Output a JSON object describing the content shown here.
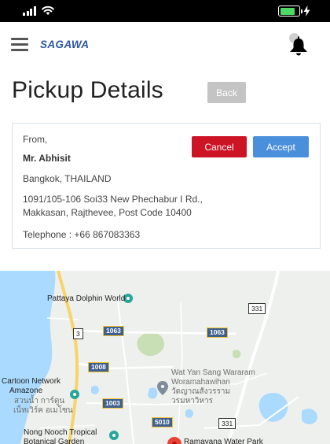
{
  "status_bar": {
    "icons": [
      "signal-icon",
      "wifi-icon",
      "battery-icon",
      "charging-bolt-icon"
    ],
    "battery_level": 0.85
  },
  "header": {
    "brand": "SAGAWA",
    "menu_icon": "hamburger-menu-icon",
    "notification_icon": "bell-icon"
  },
  "page": {
    "title": "Pickup Details",
    "back_label": "Back"
  },
  "pickup": {
    "from_label": "From,",
    "name": "Mr. Abhisit",
    "city": "Bangkok, THAILAND",
    "address_line1": "1091/105-106 Soi33 New Phechabur I Rd.,",
    "address_line2": "Makkasan, Rajthevee, Post Code 10400",
    "telephone": "Telephone : +66 867083363",
    "cancel_label": "Cancel",
    "accept_label": "Accept"
  },
  "map": {
    "places": {
      "dolphin_world": "Pattaya Dolphin World",
      "cartoon_network_1": "Cartoon Network",
      "cartoon_network_2": "Amazone",
      "cartoon_network_thai_1": "สวนน้ำ การ์ตูน",
      "cartoon_network_thai_2": "เน็ทเวิร์ค อเมโซน",
      "wat_yan_1": "Wat Yan Sang Wararam",
      "wat_yan_2": "Woramahawihan",
      "wat_yan_thai_1": "วัดญาณสังวรราม",
      "wat_yan_thai_2": "วรมหาวิหาร",
      "nong_nooch_1": "Nong Nooch Tropical",
      "nong_nooch_2": "Botanical Garden",
      "ramayana": "Ramayana Water Park"
    },
    "roads": {
      "r1063_a": "1063",
      "r1063_b": "1063",
      "r1008": "1008",
      "r1003": "1003",
      "r5010": "5010",
      "r3": "3",
      "r331_a": "331",
      "r331_b": "331"
    },
    "colors": {
      "sea": "#aadaff",
      "land": "#eef0ed",
      "park": "#c8dfb5",
      "road_major": "#f8d36a",
      "pin": "#ea4335"
    }
  },
  "colors": {
    "brand": "#2b56a3",
    "cancel": "#cc1424",
    "accept": "#4a8fdb",
    "back": "#c4c4c4"
  }
}
